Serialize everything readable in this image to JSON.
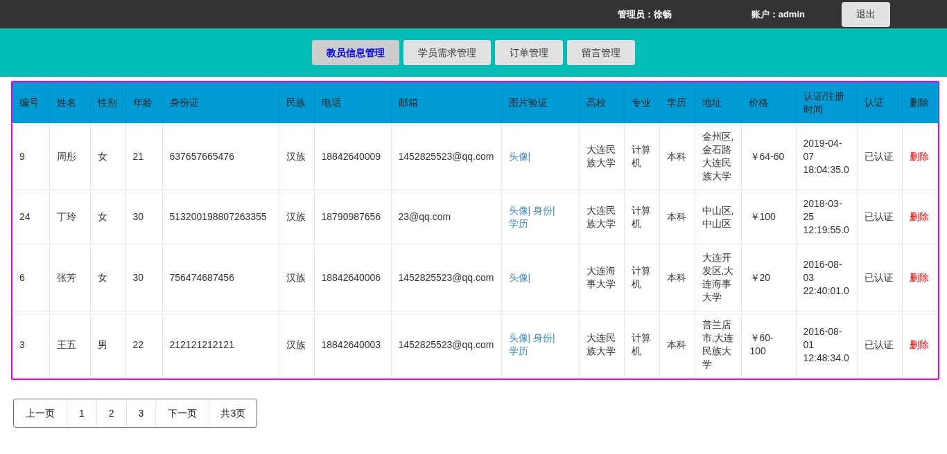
{
  "top_bar": {
    "admin": "管理员：徐畅",
    "account": "账户：admin",
    "logout": "退出"
  },
  "tabs": [
    {
      "label": "教员信息管理",
      "selected": true
    },
    {
      "label": "学员需求管理",
      "selected": false
    },
    {
      "label": "订单管理",
      "selected": false
    },
    {
      "label": "留言管理",
      "selected": false
    }
  ],
  "table": {
    "columns": [
      "编号",
      "姓名",
      "性别",
      "年龄",
      "身份证",
      "民族",
      "电话",
      "邮箱",
      "图片验证",
      "高校",
      "专业",
      "学历",
      "地址",
      "价格",
      "认证/注册时间",
      "认证",
      "删除"
    ],
    "rows": [
      {
        "id": "9",
        "name": "周彤",
        "gender": "女",
        "age": "21",
        "id_card": "637657665476",
        "ethnicity": "汉族",
        "phone": "18842640009",
        "email": "1452825523@qq.com",
        "photos": [
          "头像|"
        ],
        "school": "大连民族大学",
        "major": "计算机",
        "degree": "本科",
        "address": "金州区,金石路大连民族大学",
        "price": "￥64-60",
        "time": "2019-04-07 18:04:35.0",
        "status": "已认证",
        "delete": "删除"
      },
      {
        "id": "24",
        "name": "丁玲",
        "gender": "女",
        "age": "30",
        "id_card": "513200198807263355",
        "ethnicity": "汉族",
        "phone": "18790987656",
        "email": "23@qq.com",
        "photos": [
          "头像|",
          "身份|",
          "学历"
        ],
        "school": "大连民族大学",
        "major": "计算机",
        "degree": "本科",
        "address": "中山区,中山区",
        "price": "￥100",
        "time": "2018-03-25 12:19:55.0",
        "status": "已认证",
        "delete": "删除"
      },
      {
        "id": "6",
        "name": "张芳",
        "gender": "女",
        "age": "30",
        "id_card": "756474687456",
        "ethnicity": "汉族",
        "phone": "18842640006",
        "email": "1452825523@qq.com",
        "photos": [
          "头像|"
        ],
        "school": "大连海事大学",
        "major": "计算机",
        "degree": "本科",
        "address": "大连开发区,大连海事大学",
        "price": "￥20",
        "time": "2016-08-03 22:40:01.0",
        "status": "已认证",
        "delete": "删除"
      },
      {
        "id": "3",
        "name": "王五",
        "gender": "男",
        "age": "22",
        "id_card": "212121212121",
        "ethnicity": "汉族",
        "phone": "18842640003",
        "email": "1452825523@qq.com",
        "photos": [
          "头像|",
          "身份|",
          "学历"
        ],
        "school": "大连民族大学",
        "major": "计算机",
        "degree": "本科",
        "address": "普兰店市,大连民族大学",
        "price": "￥60-100",
        "time": "2016-08-01 12:48:34.0",
        "status": "已认证",
        "delete": "删除"
      }
    ]
  },
  "pagination": [
    {
      "label": "上一页",
      "kind": "link"
    },
    {
      "label": "1",
      "kind": "link"
    },
    {
      "label": "2",
      "kind": "link"
    },
    {
      "label": "3",
      "kind": "link"
    },
    {
      "label": "下一页",
      "kind": "link"
    },
    {
      "label": "共3页",
      "kind": "text"
    }
  ]
}
